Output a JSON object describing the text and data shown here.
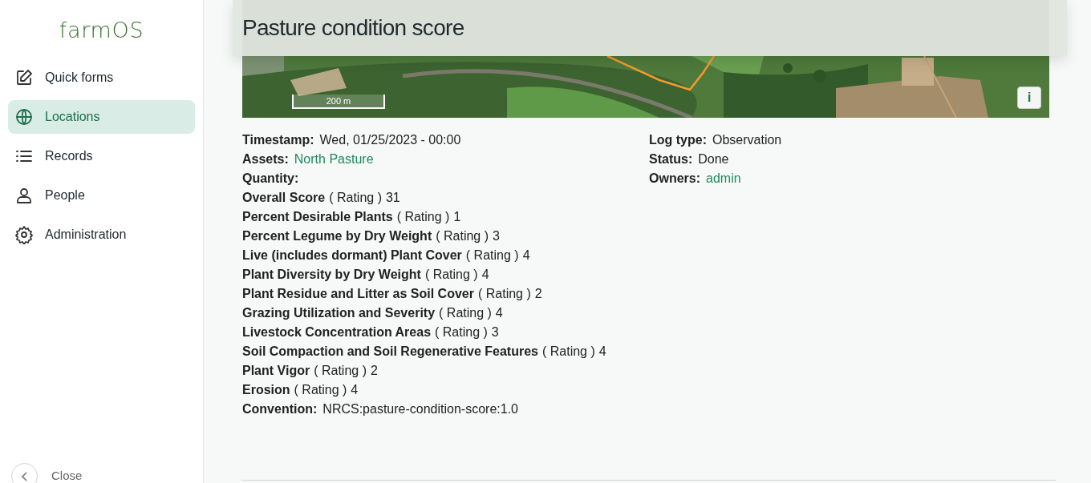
{
  "sidebar": {
    "logo": "farmOS",
    "items": [
      {
        "label": "Quick forms",
        "selected": false
      },
      {
        "label": "Locations",
        "selected": true
      },
      {
        "label": "Records",
        "selected": false
      },
      {
        "label": "People",
        "selected": false
      },
      {
        "label": "Administration",
        "selected": false
      }
    ],
    "close": {
      "label": "Close"
    }
  },
  "page": {
    "title": "Pasture condition score"
  },
  "map": {
    "scale": "200 m",
    "info_button": "i"
  },
  "details_left": [
    {
      "kind": "field",
      "label": "Timestamp:",
      "value": "Wed, 01/25/2023 - 00:00"
    },
    {
      "kind": "link",
      "label": "Assets:",
      "value": "North Pasture"
    },
    {
      "kind": "heading",
      "label": "Quantity:"
    },
    {
      "kind": "rating",
      "label": "Overall Score",
      "unit": "( Rating )",
      "value": "31"
    },
    {
      "kind": "rating",
      "label": "Percent Desirable Plants",
      "unit": "( Rating )",
      "value": "1"
    },
    {
      "kind": "rating",
      "label": "Percent Legume by Dry Weight",
      "unit": "( Rating )",
      "value": "3"
    },
    {
      "kind": "rating",
      "label": "Live (includes dormant) Plant Cover",
      "unit": "( Rating )",
      "value": "4"
    },
    {
      "kind": "rating",
      "label": "Plant Diversity by Dry Weight",
      "unit": "( Rating )",
      "value": "4"
    },
    {
      "kind": "rating",
      "label": "Plant Residue and Litter as Soil Cover",
      "unit": "( Rating )",
      "value": "2"
    },
    {
      "kind": "rating",
      "label": "Grazing Utilization and Severity",
      "unit": "( Rating )",
      "value": "4"
    },
    {
      "kind": "rating",
      "label": "Livestock Concentration Areas",
      "unit": "( Rating )",
      "value": "3"
    },
    {
      "kind": "rating",
      "label": "Soil Compaction and Soil Regenerative Features",
      "unit": "( Rating )",
      "value": "4"
    },
    {
      "kind": "rating",
      "label": "Plant Vigor",
      "unit": "( Rating )",
      "value": "2"
    },
    {
      "kind": "rating",
      "label": "Erosion",
      "unit": "( Rating )",
      "value": "4"
    },
    {
      "kind": "field",
      "label": "Convention:",
      "value": "NRCS:pasture-condition-score:1.0"
    }
  ],
  "details_right": [
    {
      "kind": "field",
      "label": "Log type:",
      "value": "Observation"
    },
    {
      "kind": "field",
      "label": "Status:",
      "value": "Done"
    },
    {
      "kind": "link",
      "label": "Owners:",
      "value": "admin"
    }
  ]
}
